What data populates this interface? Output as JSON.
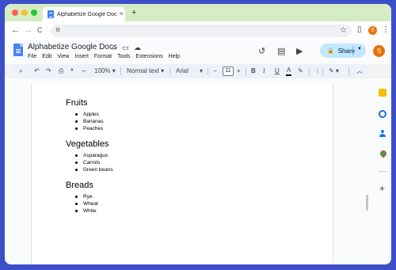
{
  "browser": {
    "tab_title": "Alphabetize Google Docs - G",
    "tab_close": "×",
    "new_tab": "+",
    "profile_initial": "S"
  },
  "icons": {
    "back": "←",
    "forward": "→",
    "reload": "C",
    "site_settings": "⚙",
    "bookmark_star": "☆",
    "sidepanel": "▯",
    "menu": "⋮"
  },
  "docs": {
    "title": "Alphabetize Google Docs",
    "menu": [
      "File",
      "Edit",
      "View",
      "Insert",
      "Format",
      "Tools",
      "Extensions",
      "Help"
    ],
    "share_label": "Share",
    "user_initial": "S"
  },
  "toolbar": {
    "zoom": "100%",
    "style": "Normal text",
    "font": "Arial",
    "font_size": "11",
    "bold": "B",
    "italic": "I",
    "underline": "U",
    "text_color": "A"
  },
  "document": {
    "sections": [
      {
        "heading": "Fruits",
        "items": [
          "Apples",
          "Bananas",
          "Peaches"
        ]
      },
      {
        "heading": "Vegetables",
        "items": [
          "Asparagus",
          "Carrots",
          "Green beans"
        ]
      },
      {
        "heading": "Breads",
        "items": [
          "Rye",
          "Wheat",
          "White"
        ]
      }
    ]
  },
  "colors": {
    "desktop": "#3d4fc8",
    "titlebar": "#d4edc4",
    "share_button": "#c2e7ff",
    "docs_blue": "#4285f4",
    "avatar": "#e8710a"
  }
}
